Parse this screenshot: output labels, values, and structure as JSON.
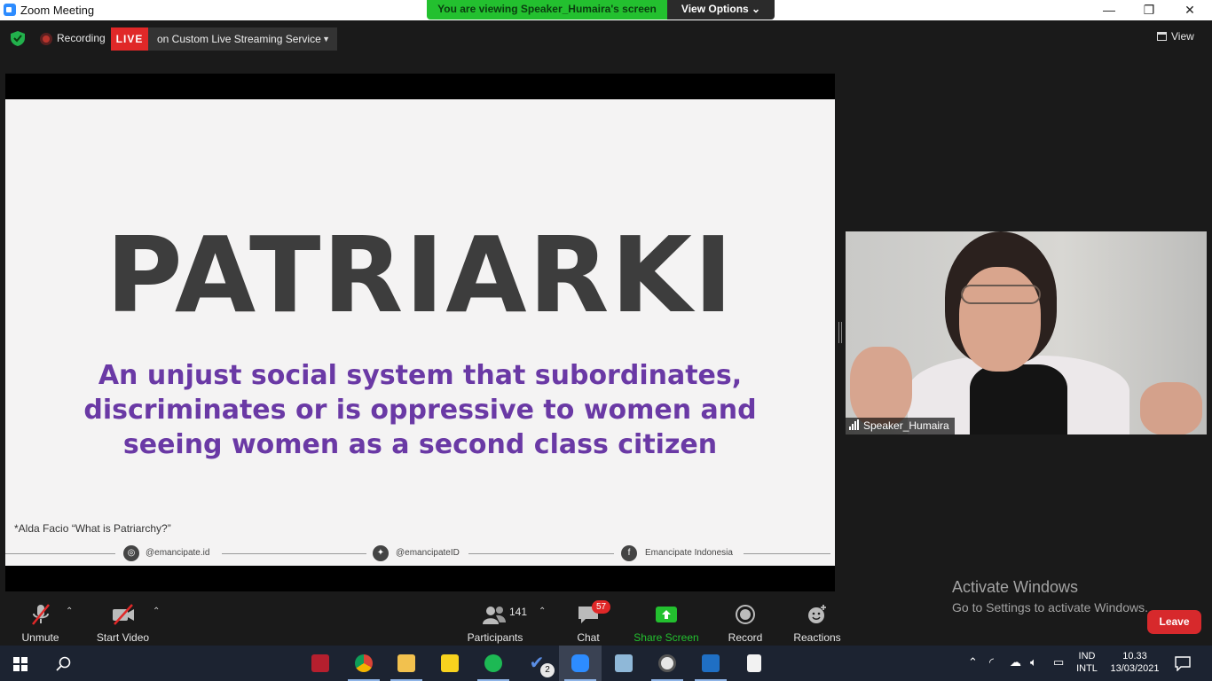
{
  "window": {
    "title": "Zoom Meeting",
    "minimize": "—",
    "restore": "❐",
    "close": "✕"
  },
  "banner": {
    "viewing_text": "You are viewing Speaker_Humaira's screen",
    "view_options": "View Options ⌄"
  },
  "toolbar": {
    "recording_label": "Recording",
    "live_badge": "LIVE",
    "live_service": "on Custom Live Streaming Service",
    "view_label": "View"
  },
  "slide": {
    "headline": "PATRIARKI",
    "definition": "An unjust social system that subordinates, discriminates or is oppressive to women and seeing women as a second class citizen",
    "source": "*Alda Facio “What is Patriarchy?”",
    "instagram": "@emancipate.id",
    "twitter": "@emancipateID",
    "facebook": "Emancipate Indonesia",
    "colors": {
      "headline": "#3d3d3d",
      "definition": "#6a39a5"
    }
  },
  "speaker": {
    "name": "Speaker_Humaira"
  },
  "watermark": {
    "line1": "Activate Windows",
    "line2": "Go to Settings to activate Windows."
  },
  "controls": {
    "unmute": "Unmute",
    "start_video": "Start Video",
    "participants": "Participants",
    "participants_count": "141",
    "chat": "Chat",
    "chat_badge": "57",
    "share_screen": "Share Screen",
    "record": "Record",
    "reactions": "Reactions",
    "leave": "Leave"
  },
  "taskbar": {
    "todo_badge": "2",
    "lang_line1": "IND",
    "lang_line2": "INTL",
    "time": "10.33",
    "date": "13/03/2021"
  }
}
